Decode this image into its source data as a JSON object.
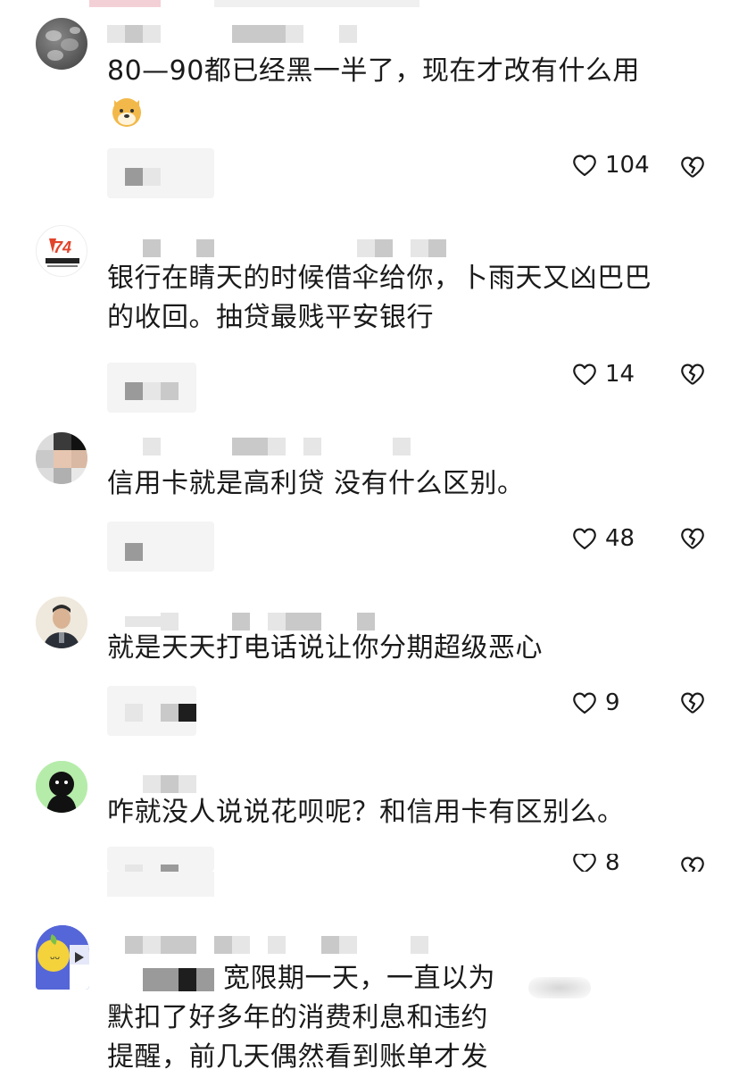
{
  "comments": [
    {
      "text_lines": [
        "80—90都已经黑一半了，现在才改有什么用"
      ],
      "emoji": "dog-face-emoji",
      "likes": "104"
    },
    {
      "text_lines": [
        "银行在睛天的时候借伞给你，卜雨天又凶巴巴",
        "的收回。抽贷最贱平安银行"
      ],
      "likes": "14"
    },
    {
      "text_lines": [
        "信用卡就是高利贷 没有什么区别。"
      ],
      "likes": "48"
    },
    {
      "text_lines": [
        "就是天天打电话说让你分期超级恶心"
      ],
      "likes": "9"
    },
    {
      "text_lines": [
        "咋就没人说说花呗呢？和信用卡有区别么。"
      ],
      "likes": "8"
    },
    {
      "text_lines": [
        "宽限期一天，一直以为",
        "默扣了好多年的消费利息和违约",
        "提醒，前几天偶然看到账单才发"
      ]
    }
  ],
  "icons": {
    "like": "heart-outline-icon",
    "dislike": "broken-heart-icon"
  },
  "colors": {
    "text": "#1a1a1a",
    "background": "#ffffff"
  }
}
